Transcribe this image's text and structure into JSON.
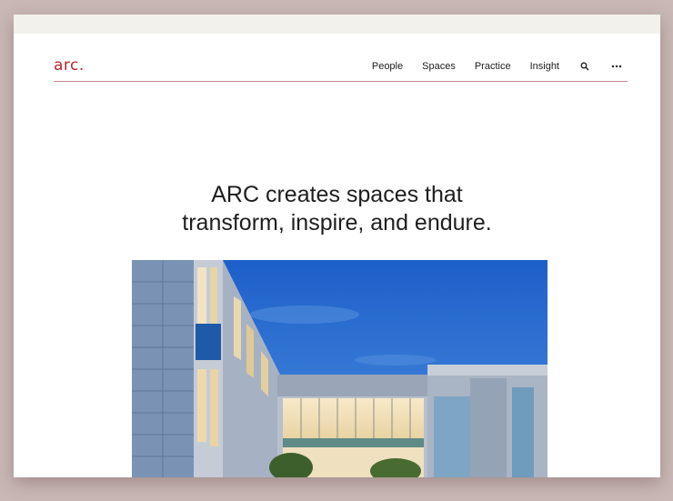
{
  "brand": {
    "logo": "arc.",
    "accent": "#b5272b"
  },
  "nav": {
    "items": [
      "People",
      "Spaces",
      "Practice",
      "Insight"
    ],
    "search_icon": "search-icon",
    "more_icon": "more-icon"
  },
  "hero": {
    "headline_line1": "ARC creates spaces that",
    "headline_line2": "transform, inspire, and endure."
  },
  "colors": {
    "page_bg": "#c9b8b5",
    "sky": "#2a6fd2",
    "rule": "#c4868a"
  }
}
